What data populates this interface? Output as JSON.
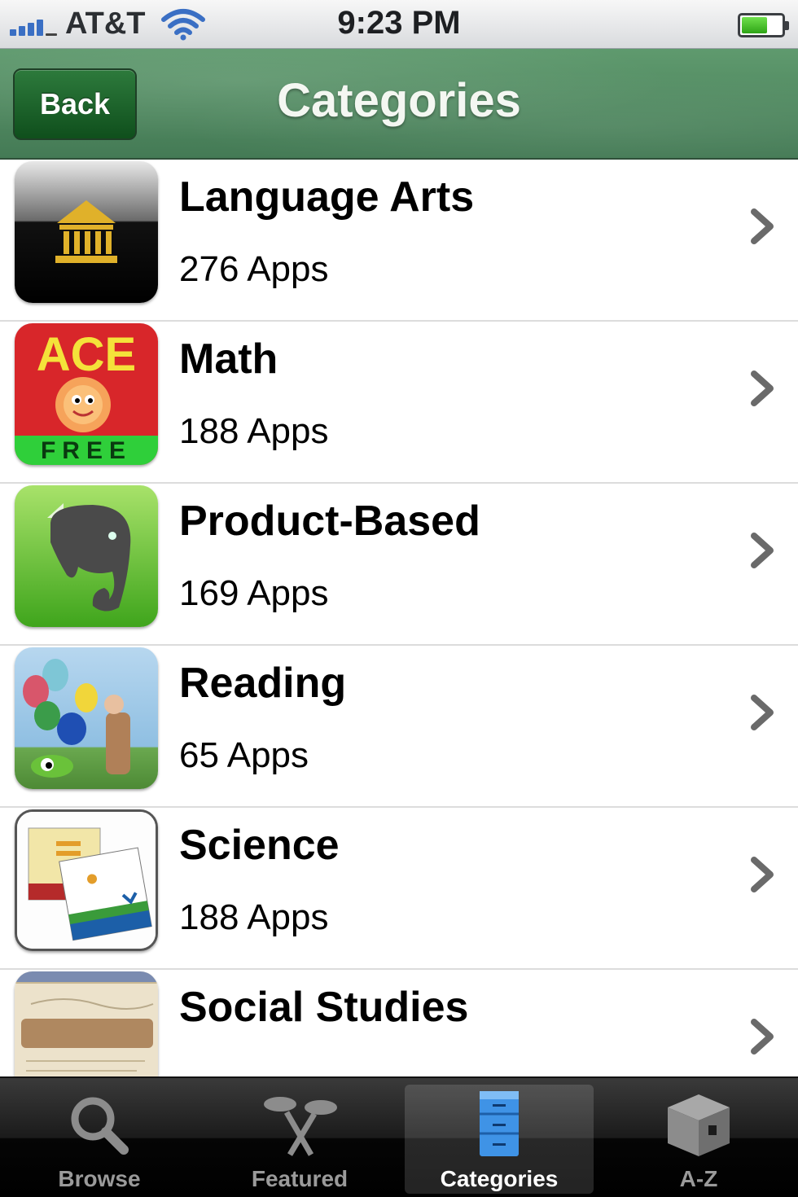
{
  "status_bar": {
    "carrier": "AT&T",
    "time": "9:23 PM",
    "signal_icon": "signal-bars-icon",
    "wifi_icon": "wifi-icon",
    "battery_icon": "battery-icon",
    "battery_level": 0.6
  },
  "nav": {
    "back_label": "Back",
    "title": "Categories",
    "bar_color": "#4f8a60"
  },
  "categories": [
    {
      "title": "Language Arts",
      "subtitle": "276 Apps",
      "icon": "library-building-icon"
    },
    {
      "title": "Math",
      "subtitle": "188 Apps",
      "icon": "ace-free-math-icon"
    },
    {
      "title": "Product-Based",
      "subtitle": "169 Apps",
      "icon": "evernote-elephant-icon"
    },
    {
      "title": "Reading",
      "subtitle": "65 Apps",
      "icon": "balloons-boy-icon"
    },
    {
      "title": "Science",
      "subtitle": "188 Apps",
      "icon": "science-cards-icon"
    },
    {
      "title": "Social Studies",
      "subtitle": "",
      "icon": "constitution-icon"
    }
  ],
  "tabs": [
    {
      "label": "Browse",
      "icon": "magnifier-icon",
      "active": false
    },
    {
      "label": "Featured",
      "icon": "featured-icon",
      "active": false
    },
    {
      "label": "Categories",
      "icon": "file-cabinet-icon",
      "active": true
    },
    {
      "label": "A-Z",
      "icon": "cube-box-icon",
      "active": false
    }
  ]
}
